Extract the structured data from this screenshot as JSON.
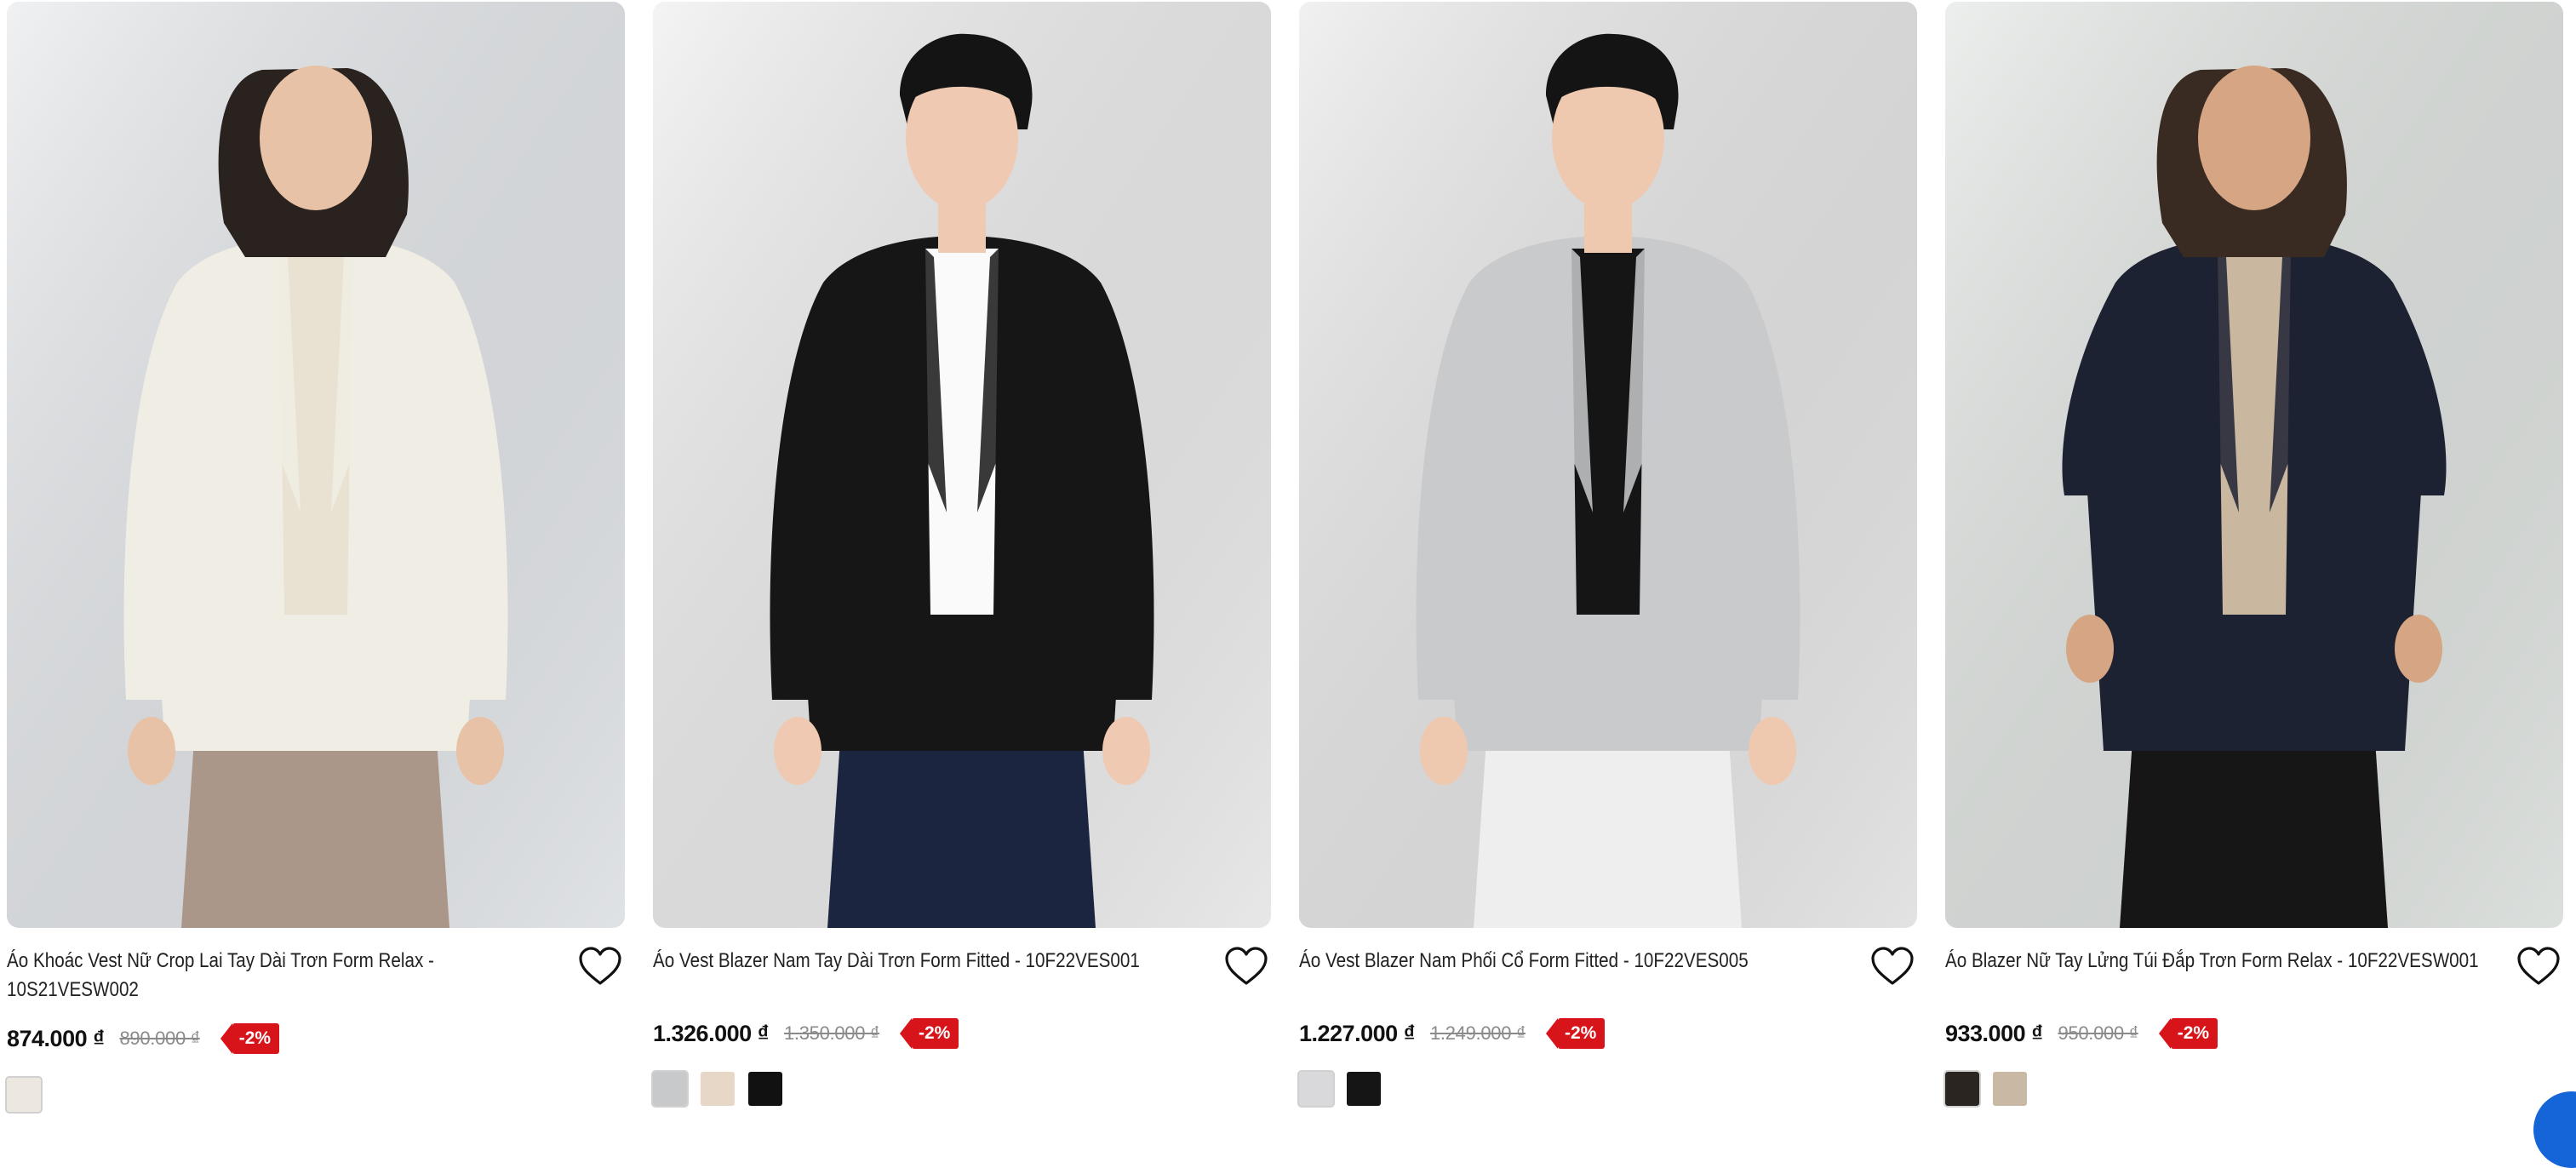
{
  "products": [
    {
      "name": "Áo Khoác Vest Nữ Crop Lai Tay Dài Trơn Form Relax - 10S21VESW002",
      "price": "874.000 ₫",
      "old_price": "890.000 ₫",
      "discount": "-2%",
      "swatches": [
        "#ece8e0"
      ],
      "photo": {
        "bg": "#e6e9ec",
        "top": "#f0ede4",
        "inner": "#e9e1d1",
        "bottom": "#ab978a",
        "skin": "#e8c2a6",
        "hair": "#2a221e"
      }
    },
    {
      "name": "Áo Vest Blazer Nam Tay Dài Trơn Form Fitted - 10F22VES001",
      "price": "1.326.000 ₫",
      "old_price": "1.350.000 ₫",
      "discount": "-2%",
      "swatches": [
        "#c8c9ca",
        "#e6d7c6",
        "#111111"
      ],
      "photo": {
        "bg": "#eeeeee",
        "top": "#161616",
        "inner": "#fafafa",
        "bottom": "#1c2540",
        "skin": "#efc9b1",
        "hair": "#141414"
      }
    },
    {
      "name": "Áo Vest Blazer Nam Phối Cổ Form Fitted - 10F22VES005",
      "price": "1.227.000 ₫",
      "old_price": "1.249.000 ₫",
      "discount": "-2%",
      "swatches": [
        "#d9d9dc",
        "#151515"
      ],
      "photo": {
        "bg": "#e9e9e9",
        "top": "#c9cacc",
        "inner": "#151515",
        "bottom": "#eeeeee",
        "skin": "#efc8b0",
        "hair": "#141414"
      }
    },
    {
      "name": "Áo Blazer Nữ Tay Lửng Túi Đắp Trơn Form Relax - 10F22VESW001",
      "price": "933.000 ₫",
      "old_price": "950.000 ₫",
      "discount": "-2%",
      "swatches": [
        "#2a2520",
        "#c8b8a4"
      ],
      "photo": {
        "bg": "#e2e6e3",
        "top": "#1d2233",
        "inner": "#c9b7a0",
        "bottom": "#161616",
        "skin": "#d6a684",
        "hair": "#3a2b22"
      }
    }
  ],
  "icons": {
    "wishlist": "heart-outline-icon",
    "chat": "chat-bubble-icon"
  },
  "colors": {
    "discount_badge": "#d7141a",
    "chat_button": "#1565d8"
  }
}
